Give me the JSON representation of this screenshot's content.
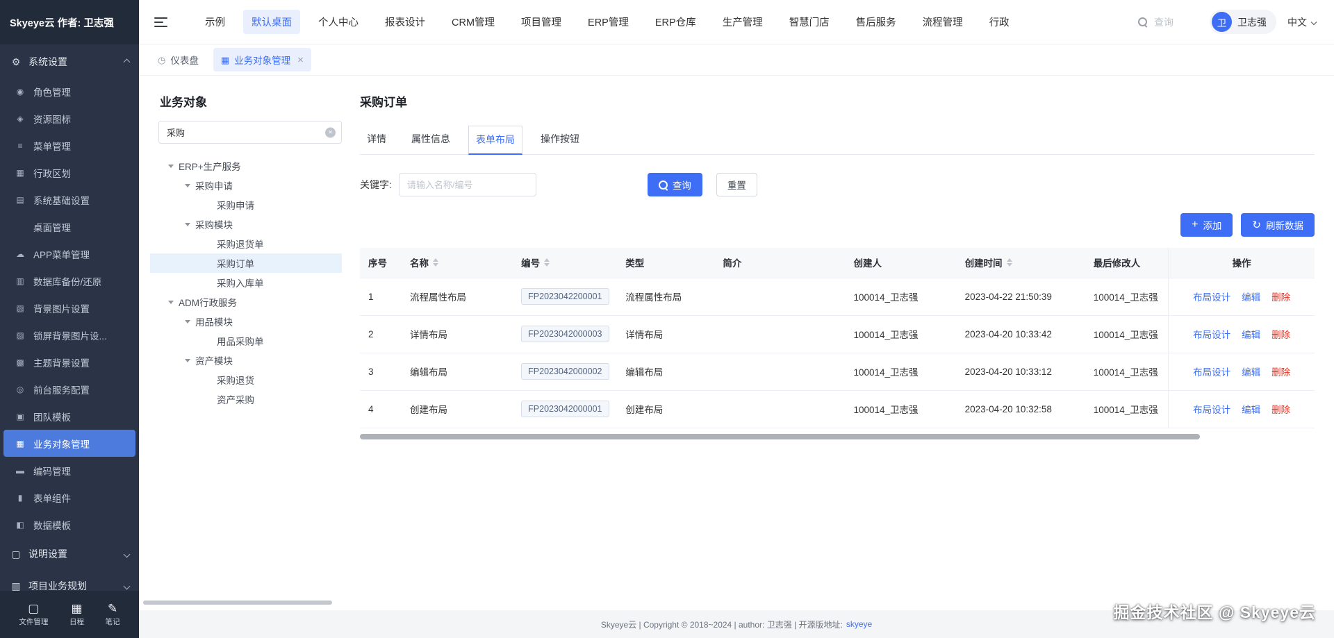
{
  "colors": {
    "primary": "#3d6ef5",
    "danger": "#e03426",
    "sidebar_bg": "#2a3446",
    "sidebar_dark": "#222b3a",
    "active_item": "#4d7add"
  },
  "icons": {
    "plus": "+",
    "refresh": "↻",
    "close": "×",
    "clear": "×"
  },
  "sidebar": {
    "brand": "Skyeye云 作者: 卫志强",
    "section_system": {
      "label": "系统设置",
      "icon": "gear",
      "glyph": "⚙"
    },
    "section_help": {
      "label": "说明设置",
      "icon": "monitor",
      "glyph": "▢"
    },
    "section_project": {
      "label": "项目业务规划",
      "icon": "modules",
      "glyph": "▥"
    },
    "active_item": "业务对象管理",
    "items": [
      {
        "label": "角色管理",
        "icon": "role",
        "glyph": "◉"
      },
      {
        "label": "资源图标",
        "icon": "resource",
        "glyph": "◈"
      },
      {
        "label": "菜单管理",
        "icon": "menu-list",
        "glyph": "≡"
      },
      {
        "label": "行政区划",
        "icon": "region",
        "glyph": "▦"
      },
      {
        "label": "系统基础设置",
        "icon": "system-settings",
        "glyph": "▤"
      },
      {
        "label": "桌面管理",
        "icon": "none",
        "glyph": ""
      },
      {
        "label": "APP菜单管理",
        "icon": "cloud",
        "glyph": "☁"
      },
      {
        "label": "数据库备份/还原",
        "icon": "database",
        "glyph": "▥"
      },
      {
        "label": "背景图片设置",
        "icon": "background-image",
        "glyph": "▧"
      },
      {
        "label": "锁屏背景图片设...",
        "icon": "lockscreen-image",
        "glyph": "▨"
      },
      {
        "label": "主题背景设置",
        "icon": "theme-image",
        "glyph": "▩"
      },
      {
        "label": "前台服务配置",
        "icon": "service-config",
        "glyph": "◎"
      },
      {
        "label": "团队模板",
        "icon": "team-template",
        "glyph": "▣"
      },
      {
        "label": "业务对象管理",
        "icon": "business-object",
        "glyph": "▦"
      },
      {
        "label": "编码管理",
        "icon": "code-rule",
        "glyph": "▬"
      },
      {
        "label": "表单组件",
        "icon": "form-widget",
        "glyph": "▮"
      },
      {
        "label": "数据模板",
        "icon": "data-template",
        "glyph": "◧"
      }
    ],
    "bottom_items": [
      {
        "label": "文件管理",
        "icon": "files",
        "glyph": "▢"
      },
      {
        "label": "日程",
        "icon": "calendar",
        "glyph": "▦"
      },
      {
        "label": "笔记",
        "icon": "note",
        "glyph": "✎"
      }
    ]
  },
  "topbar": {
    "nav_items": [
      "示例",
      "默认桌面",
      "个人中心",
      "报表设计",
      "CRM管理",
      "项目管理",
      "ERP管理",
      "ERP仓库",
      "生产管理",
      "智慧门店",
      "售后服务",
      "流程管理",
      "行政"
    ],
    "active_nav": "默认桌面",
    "search_placeholder": "查询",
    "user": {
      "initial": "卫",
      "name": "卫志强",
      "lang": "中文"
    }
  },
  "tabbar": {
    "tabs": [
      {
        "label": "仪表盘",
        "icon": "dashboard-clock",
        "glyph": "◷",
        "active": false,
        "closable": false
      },
      {
        "label": "业务对象管理",
        "icon": "business-grid",
        "glyph": "▦",
        "active": true,
        "closable": true
      }
    ]
  },
  "tree_panel": {
    "title": "业务对象",
    "search_value": "采购",
    "nodes": [
      {
        "label": "ERP+生产服务",
        "depth": 0,
        "expandable": true
      },
      {
        "label": "采购申请",
        "depth": 1,
        "expandable": true
      },
      {
        "label": "采购申请",
        "depth": 2
      },
      {
        "label": "采购模块",
        "depth": 1,
        "expandable": true
      },
      {
        "label": "采购退货单",
        "depth": 2
      },
      {
        "label": "采购订单",
        "depth": 2,
        "selected": true
      },
      {
        "label": "采购入库单",
        "depth": 2
      },
      {
        "label": "ADM行政服务",
        "depth": 0,
        "expandable": true
      },
      {
        "label": "用品模块",
        "depth": 1,
        "expandable": true
      },
      {
        "label": "用品采购单",
        "depth": 2
      },
      {
        "label": "资产模块",
        "depth": 1,
        "expandable": true
      },
      {
        "label": "采购退货",
        "depth": 2
      },
      {
        "label": "资产采购",
        "depth": 2
      }
    ]
  },
  "detail": {
    "title": "采购订单",
    "tabs": [
      "详情",
      "属性信息",
      "表单布局",
      "操作按钮"
    ],
    "active_tab": "表单布局",
    "filter": {
      "label": "关键字:",
      "placeholder": "请输入名称/编号",
      "search_label": "查询",
      "reset_label": "重置"
    },
    "toolbar": {
      "add_label": "添加",
      "refresh_label": "刷新数据"
    },
    "table": {
      "columns": [
        {
          "label": "序号",
          "sortable": false
        },
        {
          "label": "名称",
          "sortable": true
        },
        {
          "label": "编号",
          "sortable": true
        },
        {
          "label": "类型",
          "sortable": false
        },
        {
          "label": "简介",
          "sortable": false
        },
        {
          "label": "创建人",
          "sortable": false
        },
        {
          "label": "创建时间",
          "sortable": true
        },
        {
          "label": "最后修改人",
          "sortable": false
        },
        {
          "label": "操作",
          "sortable": false
        }
      ],
      "rows": [
        {
          "no": "1",
          "name": "流程属性布局",
          "code": "FP2023042200001",
          "type": "流程属性布局",
          "desc": "",
          "creator": "100014_卫志强",
          "created": "2023-04-22 21:50:39",
          "modifier": "100014_卫志强"
        },
        {
          "no": "2",
          "name": "详情布局",
          "code": "FP2023042000003",
          "type": "详情布局",
          "desc": "",
          "creator": "100014_卫志强",
          "created": "2023-04-20 10:33:42",
          "modifier": "100014_卫志强"
        },
        {
          "no": "3",
          "name": "编辑布局",
          "code": "FP2023042000002",
          "type": "编辑布局",
          "desc": "",
          "creator": "100014_卫志强",
          "created": "2023-04-20 10:33:12",
          "modifier": "100014_卫志强"
        },
        {
          "no": "4",
          "name": "创建布局",
          "code": "FP2023042000001",
          "type": "创建布局",
          "desc": "",
          "creator": "100014_卫志强",
          "created": "2023-04-20 10:32:58",
          "modifier": "100014_卫志强"
        }
      ],
      "row_actions": [
        {
          "label": "布局设计",
          "style": "link"
        },
        {
          "label": "编辑",
          "style": "link"
        },
        {
          "label": "删除",
          "style": "danger"
        }
      ]
    }
  },
  "footer": {
    "text": "Skyeye云 | Copyright © 2018~2024 | author: 卫志强 | 开源版地址:",
    "link": "skyeye"
  },
  "watermark": "掘金技术社区 @ Skyeye云"
}
